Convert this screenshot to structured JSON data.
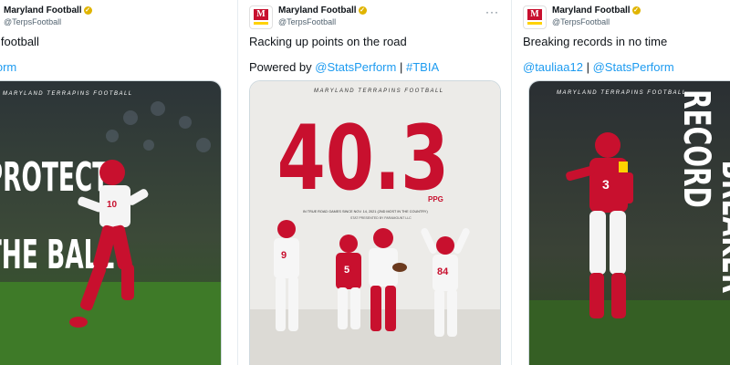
{
  "tweets": [
    {
      "author": "Maryland Football",
      "handle": "@TerpsFootball",
      "text": "t the football",
      "links": [
        "Perform"
      ],
      "poster": {
        "heading": "MARYLAND TERRAPINS FOOTBALL",
        "headline_1": "PROTECT",
        "headline_2": "THE BALL",
        "jersey": "10"
      }
    },
    {
      "author": "Maryland Football",
      "handle": "@TerpsFootball",
      "text": "Racking up points on the road",
      "powered_label": "Powered by",
      "links": [
        "@StatsPerform",
        "#TBIA"
      ],
      "separator": "|",
      "poster": {
        "heading": "MARYLAND TERRAPINS FOOTBALL",
        "big_stat": "40.3",
        "unit": "PPG",
        "caption_1": "IN TRUE ROAD GAMES SINCE NOV. 14, 2021 (2ND MOST IN THE COUNTRY)",
        "caption_2": "STAT PRESENTED BY PARAMOUNT LLC",
        "jerseys": [
          "9",
          "5",
          "84"
        ]
      }
    },
    {
      "author": "Maryland Football",
      "handle": "@TerpsFootball",
      "text": "Breaking records in no time",
      "links": [
        "@tauliaa12",
        "@StatsPerform"
      ],
      "separator": "|",
      "poster": {
        "heading": "MARYLAND TERRAPINS FOOTBALL",
        "headline_1": "RECORD",
        "headline_2": "BREAKER",
        "jersey": "3"
      }
    }
  ],
  "colors": {
    "brand_red": "#c8102e",
    "brand_gold": "#ffd200",
    "link": "#1d9bf0"
  },
  "icons": {
    "more": "more-icon",
    "verified": "verified-icon"
  },
  "more_glyph": "···",
  "verified_glyph": "✓",
  "avatar_letter": "M"
}
